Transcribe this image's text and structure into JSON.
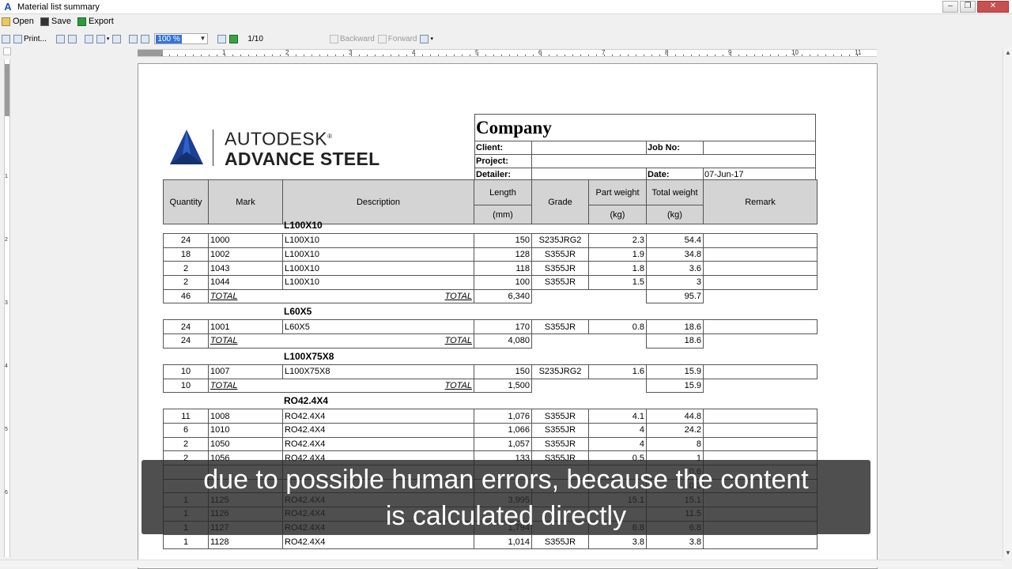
{
  "window": {
    "title": "Material list summary",
    "app_icon": "A"
  },
  "menu": {
    "open": "Open",
    "save": "Save",
    "export": "Export"
  },
  "toolbar": {
    "print": "Print...",
    "zoom": "100 %",
    "page": "1/10",
    "backward": "Backward",
    "forward": "Forward"
  },
  "ruler": {
    "numbers": [
      "1",
      "2",
      "3",
      "4",
      "5",
      "6",
      "7",
      "8",
      "9",
      "10",
      "11"
    ]
  },
  "vruler": {
    "numbers": [
      "1",
      "2",
      "3",
      "4",
      "5",
      "6"
    ]
  },
  "logo": {
    "line1": "AUTODESK",
    "reg": "®",
    "line2": "ADVANCE STEEL",
    "brand_color": "#1c3f94"
  },
  "header": {
    "company": "Company",
    "client_label": "Client:",
    "client": "",
    "job_label": "Job No:",
    "job": "",
    "project_label": "Project:",
    "project": "",
    "detailer_label": "Detailer:",
    "detailer": "",
    "date_label": "Date:",
    "date": "07-Jun-17"
  },
  "columns": {
    "quantity": "Quantity",
    "mark": "Mark",
    "description": "Description",
    "length": "Length",
    "length_unit": "(mm)",
    "grade": "Grade",
    "part_weight": "Part weight",
    "part_weight_unit": "(kg)",
    "total_weight": "Total weight",
    "total_weight_unit": "(kg)",
    "remark": "Remark"
  },
  "sections": [
    {
      "title": "L100X10",
      "rows": [
        {
          "qty": "24",
          "mark": "1000",
          "desc": "L100X10",
          "len": "150",
          "grade": "S235JRG2",
          "pw": "2.3",
          "tw": "54.4"
        },
        {
          "qty": "18",
          "mark": "1002",
          "desc": "L100X10",
          "len": "128",
          "grade": "S355JR",
          "pw": "1.9",
          "tw": "34.8"
        },
        {
          "qty": "2",
          "mark": "1043",
          "desc": "L100X10",
          "len": "118",
          "grade": "S355JR",
          "pw": "1.8",
          "tw": "3.6"
        },
        {
          "qty": "2",
          "mark": "1044",
          "desc": "L100X10",
          "len": "100",
          "grade": "S355JR",
          "pw": "1.5",
          "tw": "3"
        }
      ],
      "total": {
        "qty": "46",
        "label": "TOTAL",
        "label2": "TOTAL",
        "len": "6,340",
        "tw": "95.7"
      }
    },
    {
      "title": "L60X5",
      "rows": [
        {
          "qty": "24",
          "mark": "1001",
          "desc": "L60X5",
          "len": "170",
          "grade": "S355JR",
          "pw": "0.8",
          "tw": "18.6"
        }
      ],
      "total": {
        "qty": "24",
        "label": "TOTAL",
        "label2": "TOTAL",
        "len": "4,080",
        "tw": "18.6"
      }
    },
    {
      "title": "L100X75X8",
      "rows": [
        {
          "qty": "10",
          "mark": "1007",
          "desc": "L100X75X8",
          "len": "150",
          "grade": "S235JRG2",
          "pw": "1.6",
          "tw": "15.9"
        }
      ],
      "total": {
        "qty": "10",
        "label": "TOTAL",
        "label2": "TOTAL",
        "len": "1,500",
        "tw": "15.9"
      }
    },
    {
      "title": "RO42.4X4",
      "rows": [
        {
          "qty": "11",
          "mark": "1008",
          "desc": "RO42.4X4",
          "len": "1,076",
          "grade": "S355JR",
          "pw": "4.1",
          "tw": "44.8"
        },
        {
          "qty": "6",
          "mark": "1010",
          "desc": "RO42.4X4",
          "len": "1,066",
          "grade": "S355JR",
          "pw": "4",
          "tw": "24.2"
        },
        {
          "qty": "2",
          "mark": "1050",
          "desc": "RO42.4X4",
          "len": "1,057",
          "grade": "S355JR",
          "pw": "4",
          "tw": "8"
        },
        {
          "qty": "2",
          "mark": "1056",
          "desc": "RO42.4X4",
          "len": "133",
          "grade": "S355JR",
          "pw": "0.5",
          "tw": "1"
        },
        {
          "qty": "",
          "mark": "",
          "desc": "",
          "len": "",
          "grade": "",
          "pw": "",
          "tw": "0.6"
        },
        {
          "qty": "",
          "mark": "",
          "desc": "",
          "len": "",
          "grade": "",
          "pw": "",
          "tw": "0.3"
        },
        {
          "qty": "1",
          "mark": "1125",
          "desc": "RO42.4X4",
          "len": "3,995",
          "grade": "",
          "pw": "15.1",
          "tw": "15.1"
        },
        {
          "qty": "1",
          "mark": "1126",
          "desc": "RO42.4X4",
          "len": "",
          "grade": "",
          "pw": "",
          "tw": "11.5"
        },
        {
          "qty": "1",
          "mark": "1127",
          "desc": "RO42.4X4",
          "len": "1,794",
          "grade": "",
          "pw": "6.8",
          "tw": "6.8"
        },
        {
          "qty": "1",
          "mark": "1128",
          "desc": "RO42.4X4",
          "len": "1,014",
          "grade": "S355JR",
          "pw": "3.8",
          "tw": "3.8"
        }
      ]
    }
  ],
  "caption": {
    "line1": "due to possible human errors, because the content",
    "line2": "is calculated directly"
  }
}
